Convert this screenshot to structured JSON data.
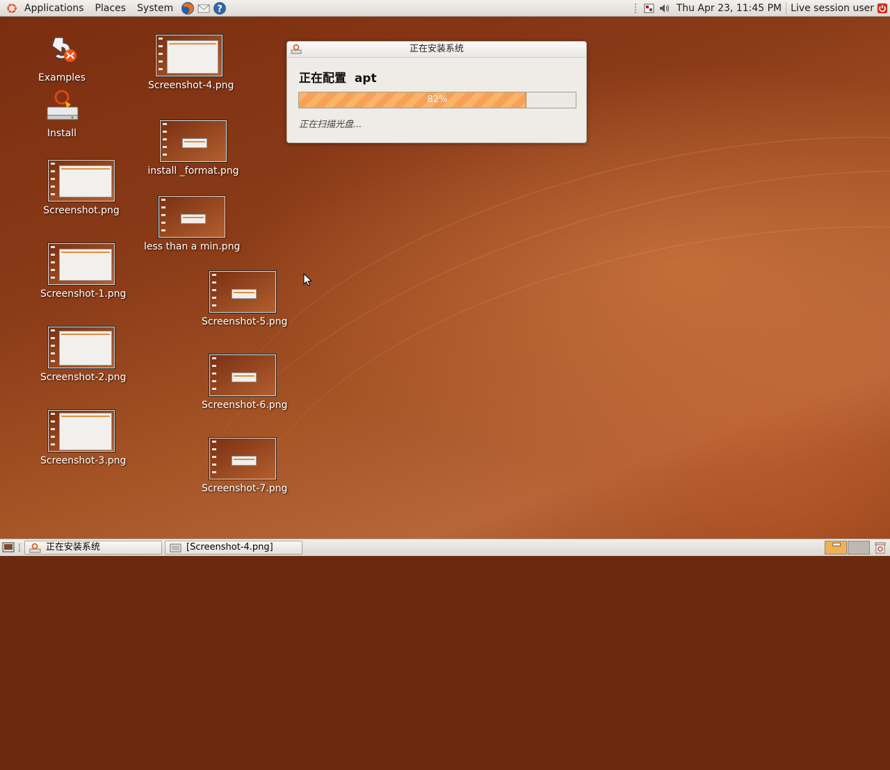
{
  "top_panel": {
    "menus": [
      "Applications",
      "Places",
      "System"
    ],
    "clock": "Thu Apr 23, 11:45 PM",
    "user": "Live session user"
  },
  "desktop": {
    "icons": {
      "examples": "Examples",
      "install": "Install",
      "screenshot": "Screenshot.png",
      "screenshot1": "Screenshot-1.png",
      "screenshot2": "Screenshot-2.png",
      "screenshot3": "Screenshot-3.png",
      "screenshot4": "Screenshot-4.png",
      "install_format": "install _format.png",
      "less_than_a_min": "less than a min.png",
      "screenshot5": "Screenshot-5.png",
      "screenshot6": "Screenshot-6.png",
      "screenshot7": "Screenshot-7.png"
    }
  },
  "dialog": {
    "title": "正在安装系统",
    "heading": "正在配置  apt",
    "progress": 0.82,
    "progress_text": "82%",
    "status": "正在扫描光盘..."
  },
  "taskbar": {
    "tasks": [
      "正在安装系统",
      "[Screenshot-4.png]"
    ]
  },
  "colors": {
    "accent": "#f5a257",
    "panel": "#e8e5e0"
  }
}
